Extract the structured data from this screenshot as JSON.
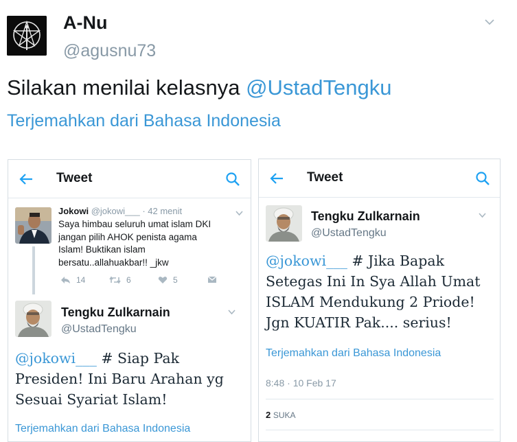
{
  "tweet": {
    "display_name": "A-Nu",
    "handle": "@agusnu73",
    "text_plain": "Silakan menilai kelasnya ",
    "text_mention": "@UstadTengku",
    "translate_link": "Terjemahkan dari Bahasa Indonesia",
    "icons": {
      "avatar": "pentagram-avatar",
      "menu": "chevron-down-icon"
    }
  },
  "left_screenshot": {
    "header_title": "Tweet",
    "reply": {
      "name": "Jokowi",
      "handle": "@jokowi___",
      "time": "· 42 menit",
      "lines": [
        "Saya himbau seluruh umat islam DKI",
        "jangan pilih AHOK penista agama",
        "Islam! Buktikan islam",
        "bersatu..allahuakbar!! _jkw"
      ],
      "reply_count": "14",
      "retweet_count": "6",
      "like_count": "5"
    },
    "main": {
      "name": "Tengku Zulkarnain",
      "handle": "@UstadTengku",
      "mention": "@jokowi___",
      "line1_rest": " # Siap Pak",
      "line2": "Presiden! Ini Baru Arahan yg",
      "line3": "Sesuai Syariat Islam!",
      "translate": "Terjemahkan dari Bahasa Indonesia"
    }
  },
  "right_screenshot": {
    "header_title": "Tweet",
    "name": "Tengku Zulkarnain",
    "handle": "@UstadTengku",
    "mention": "@jokowi___",
    "line1_rest": " # Jika Bapak",
    "line2": "Setegas Ini In Sya Allah Umat",
    "line3": "ISLAM Mendukung 2 Priode!",
    "line4": "Jgn KUATIR Pak.... serius!",
    "translate": "Terjemahkan dari Bahasa Indonesia",
    "timestamp": "8:48 · 10 Feb 17",
    "likes_count": "2",
    "likes_label": "SUKA"
  },
  "colors": {
    "link": "#3a97d6",
    "muted": "#8899a6",
    "text": "#14171a"
  }
}
